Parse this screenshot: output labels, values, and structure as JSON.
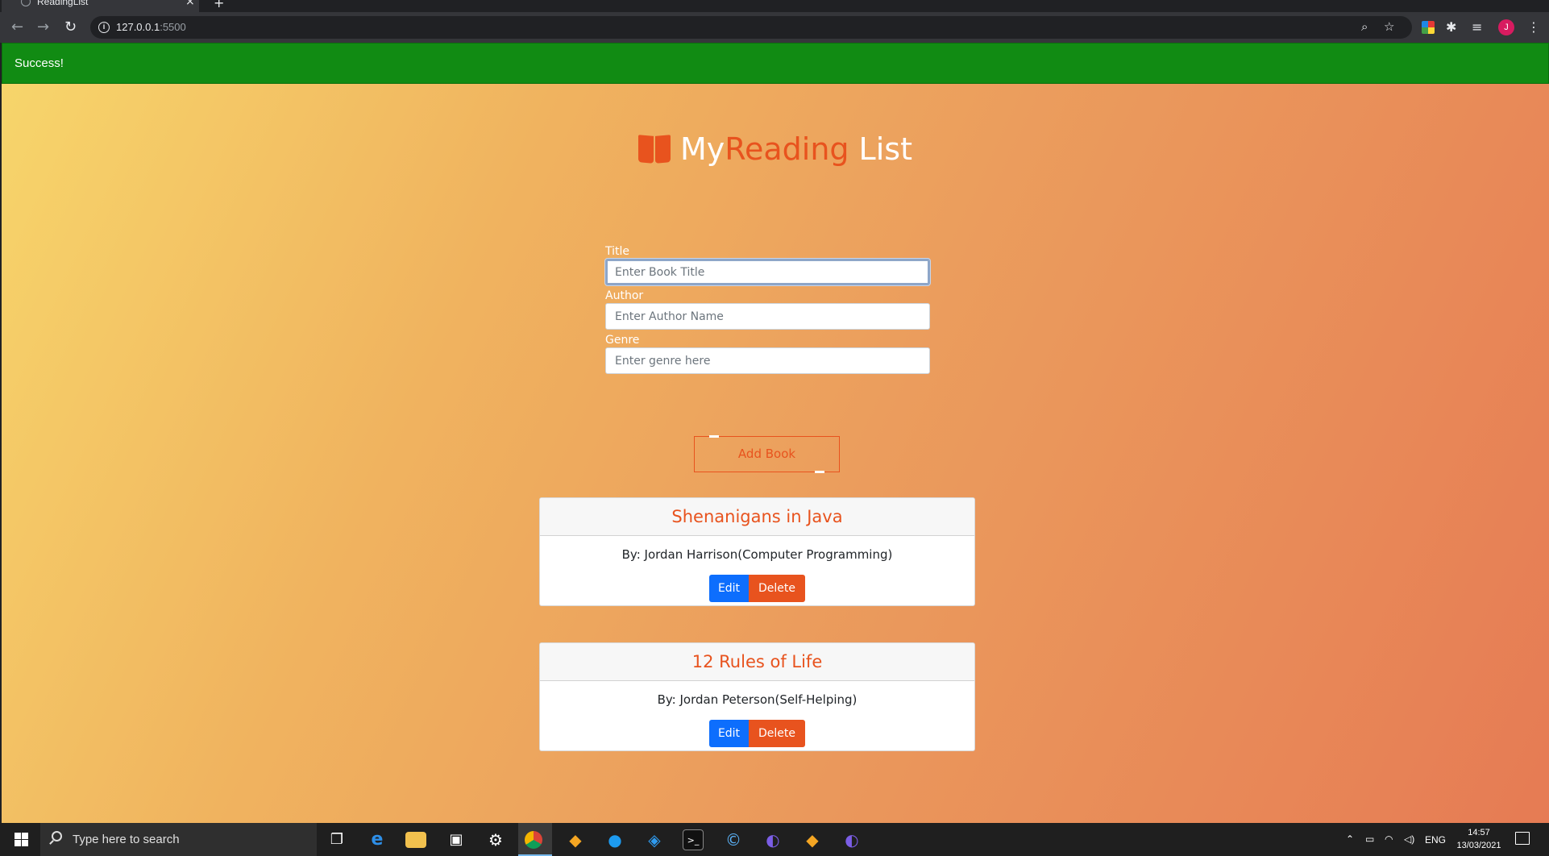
{
  "browser": {
    "tab_title": "ReadingList",
    "url_host": "127.0.0.1",
    "url_port": ":5500",
    "profile_initial": "J"
  },
  "alert": {
    "text": "Success!"
  },
  "heading": {
    "my": "My",
    "reading": "Reading",
    "list": "List"
  },
  "form": {
    "title_label": "Title",
    "title_placeholder": "Enter Book Title",
    "author_label": "Author",
    "author_placeholder": "Enter Author Name",
    "genre_label": "Genre",
    "genre_placeholder": "Enter genre here",
    "submit_label": "Add Book"
  },
  "books": [
    {
      "title": "Shenanigans in Java",
      "byline": "By: Jordan Harrison(Computer Programming)",
      "edit_label": "Edit",
      "delete_label": "Delete"
    },
    {
      "title": "12 Rules of Life",
      "byline": "By: Jordan Peterson(Self-Helping)",
      "edit_label": "Edit",
      "delete_label": "Delete"
    }
  ],
  "taskbar": {
    "search_placeholder": "Type here to search",
    "language": "ENG",
    "time": "14:57",
    "date": "13/03/2021"
  },
  "colors": {
    "accent": "#e8531e",
    "success": "#118b13",
    "edit": "#0d6efd"
  }
}
